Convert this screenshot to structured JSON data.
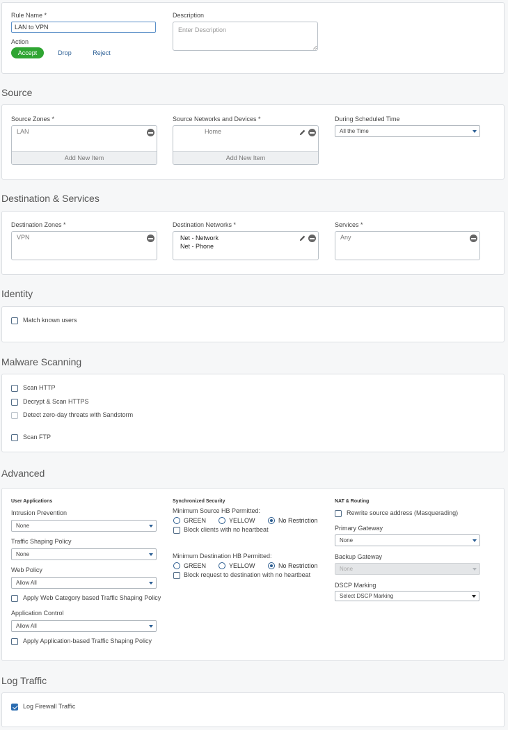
{
  "rule": {
    "name_label": "Rule Name *",
    "name_value": "LAN to VPN",
    "action_label": "Action",
    "actions": [
      "Accept",
      "Drop",
      "Reject"
    ],
    "selected_action": "Accept",
    "description_label": "Description",
    "description_placeholder": "Enter Description"
  },
  "source": {
    "title": "Source",
    "zones_label": "Source Zones *",
    "zones": [
      "LAN"
    ],
    "networks_label": "Source Networks and Devices *",
    "networks": [
      "Home"
    ],
    "add_new_item": "Add New Item",
    "schedule_label": "During Scheduled Time",
    "schedule_value": "All the Time"
  },
  "destination": {
    "title": "Destination & Services",
    "zones_label": "Destination Zones *",
    "zones": [
      "VPN"
    ],
    "networks_label": "Destination Networks *",
    "networks": [
      "Net - Network",
      "Net - Phone"
    ],
    "services_label": "Services *",
    "services": [
      "Any"
    ]
  },
  "identity": {
    "title": "Identity",
    "match_known_users": "Match known users"
  },
  "malware": {
    "title": "Malware Scanning",
    "scan_http": "Scan HTTP",
    "decrypt_https": "Decrypt & Scan HTTPS",
    "sandstorm": "Detect zero-day threats with Sandstorm",
    "scan_ftp": "Scan FTP"
  },
  "advanced": {
    "title": "Advanced",
    "user_apps_heading": "User Applications",
    "ips_label": "Intrusion Prevention",
    "ips_value": "None",
    "shaping_label": "Traffic Shaping Policy",
    "shaping_value": "None",
    "web_policy_label": "Web Policy",
    "web_policy_value": "Allow All",
    "web_category_shaping": "Apply Web Category based Traffic Shaping Policy",
    "app_control_label": "Application Control",
    "app_control_value": "Allow All",
    "app_shaping": "Apply Application-based Traffic Shaping Policy",
    "sync_heading": "Synchronized Security",
    "min_source_label": "Minimum Source HB Permitted:",
    "hb_options": [
      "GREEN",
      "YELLOW",
      "No Restriction"
    ],
    "block_no_heartbeat": "Block clients with no heartbeat",
    "min_dest_label": "Minimum Destination HB Permitted:",
    "block_dest_no_heartbeat": "Block request to destination with no heartbeat",
    "nat_heading": "NAT & Routing",
    "rewrite_source": "Rewrite source address (Masquerading)",
    "primary_gw_label": "Primary Gateway",
    "primary_gw_value": "None",
    "backup_gw_label": "Backup Gateway",
    "backup_gw_value": "None",
    "dscp_label": "DSCP Marking",
    "dscp_value": "Select DSCP Marking"
  },
  "log": {
    "title": "Log Traffic",
    "log_firewall": "Log Firewall Traffic",
    "log_firewall_checked": true
  }
}
